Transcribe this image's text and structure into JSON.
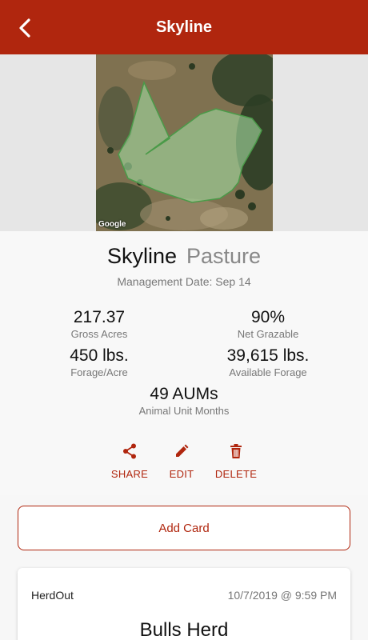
{
  "header": {
    "title": "Skyline"
  },
  "map": {
    "attribution": "Google"
  },
  "pasture": {
    "name": "Skyline",
    "type": "Pasture",
    "management_date": "Management Date: Sep 14"
  },
  "stats": {
    "gross_acres": {
      "value": "217.37",
      "label": "Gross Acres"
    },
    "net_grazable": {
      "value": "90%",
      "label": "Net Grazable"
    },
    "forage_acre": {
      "value": "450 lbs.",
      "label": "Forage/Acre"
    },
    "available_forage": {
      "value": "39,615 lbs.",
      "label": "Available Forage"
    },
    "aums": {
      "value": "49 AUMs",
      "label": "Animal Unit Months"
    }
  },
  "actions": {
    "share": "SHARE",
    "edit": "EDIT",
    "delete": "DELETE"
  },
  "add_card": {
    "label": "Add Card"
  },
  "card": {
    "source": "HerdOut",
    "timestamp": "10/7/2019 @ 9:59 PM",
    "title": "Bulls Herd"
  },
  "colors": {
    "brand": "#b0260e",
    "polygon": "#5fae5f"
  }
}
